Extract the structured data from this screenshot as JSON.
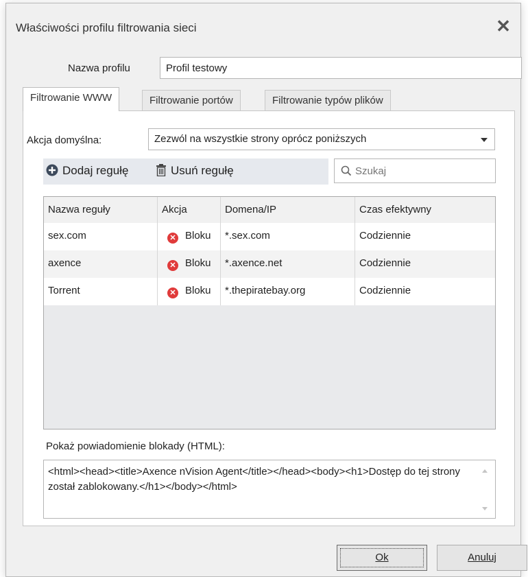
{
  "window": {
    "title": "Właściwości profilu filtrowania sieci"
  },
  "profile": {
    "label": "Nazwa profilu",
    "value": "Profil testowy"
  },
  "tabs": [
    {
      "label": "Filtrowanie WWW",
      "active": true
    },
    {
      "label": "Filtrowanie portów",
      "active": false
    },
    {
      "label": "Filtrowanie typów plików",
      "active": false
    }
  ],
  "default_action": {
    "label": "Akcja domyślna:",
    "value": "Zezwól na wszystkie strony oprócz poniższych"
  },
  "toolbar": {
    "add_label": "Dodaj regułę",
    "remove_label": "Usuń regułę",
    "search_placeholder": "Szukaj"
  },
  "table": {
    "columns": [
      "Nazwa reguły",
      "Akcja",
      "Domena/IP",
      "Czas efektywny"
    ],
    "rows": [
      {
        "name": "sex.com",
        "action": "Bloku",
        "domain": "*.sex.com",
        "time": "Codziennie"
      },
      {
        "name": "axence",
        "action": "Bloku",
        "domain": "*.axence.net",
        "time": "Codziennie"
      },
      {
        "name": "Torrent",
        "action": "Bloku",
        "domain": "*.thepiratebay.org",
        "time": "Codziennie"
      }
    ]
  },
  "notification": {
    "label": "Pokaż powiadomienie blokady (HTML):",
    "value": "<html><head><title>Axence nVision Agent</title></head><body><h1>Dostęp do tej strony został zablokowany.</h1></body></html>"
  },
  "buttons": {
    "ok": "Ok",
    "cancel": "Anuluj"
  },
  "colors": {
    "block_icon": "#e03b3b",
    "panel_bg": "#ffffff",
    "window_bg": "#f0f0f0"
  },
  "icons": {
    "add": "plus-circle-icon",
    "remove": "trash-icon",
    "search": "search-icon",
    "close": "close-icon",
    "block": "block-x-icon"
  }
}
